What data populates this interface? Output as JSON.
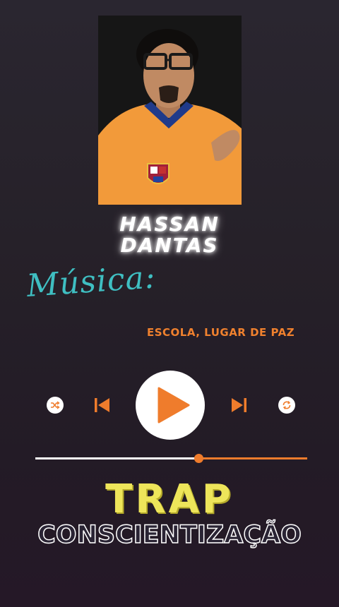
{
  "artist": {
    "line1": "HASSAN",
    "line2": "DANTAS"
  },
  "musica_label": "Música:",
  "song_title": "ESCOLA, LUGAR DE PAZ",
  "player": {
    "shuffle_icon": "shuffle-icon",
    "previous_icon": "skip-previous-icon",
    "play_icon": "play-icon",
    "next_icon": "skip-next-icon",
    "repeat_icon": "repeat-icon",
    "progress_fraction": 0.6,
    "accent_color": "#ef7c2c"
  },
  "genre": "TRAP",
  "subtitle": "CONSCIENTIZAÇÃO",
  "colors": {
    "artist_glow": "#ffffff",
    "musica_label": "#3fbfc2",
    "song_title": "#f0812e",
    "genre": "#eee55a"
  }
}
